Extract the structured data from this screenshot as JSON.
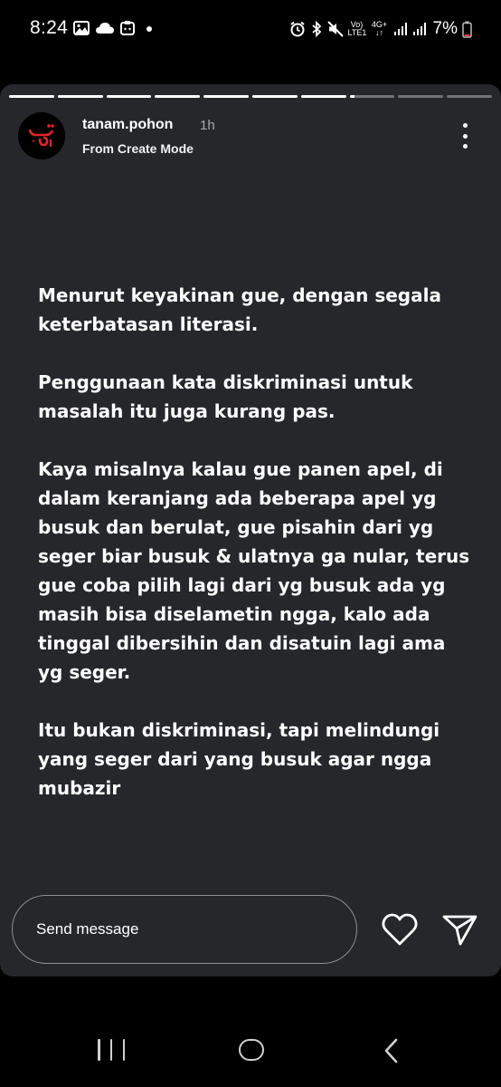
{
  "status_bar": {
    "time": "8:24",
    "left_icons": [
      "image-icon",
      "cloud-icon",
      "clipboard-icon"
    ],
    "network_label_top": "Vo)",
    "network_label_bottom": "LTE1",
    "network_type": "4G+",
    "battery_percent": "7%",
    "right_icons": [
      "alarm-icon",
      "bluetooth-icon",
      "mute-icon",
      "signal-icon",
      "signal-icon",
      "battery-icon"
    ]
  },
  "story": {
    "progress": {
      "segment_count": 10,
      "completed_segments": 7,
      "current_segment_fill": 0.1
    },
    "username": "tanam.pohon",
    "time_ago": "1h",
    "subtitle": "From Create Mode",
    "paragraphs": [
      "Menurut keyakinan gue, dengan segala keterbatasan literasi.",
      "Penggunaan kata diskriminasi untuk masalah itu juga kurang pas.",
      "Kaya misalnya kalau gue panen apel, di dalam keranjang ada beberapa apel yg busuk dan berulat, gue pisahin dari yg seger biar busuk & ulatnya ga nular, terus gue coba pilih lagi dari yg busuk ada yg masih bisa diselametin ngga, kalo ada tinggal dibersihin dan disatuin lagi ama yg seger.",
      "Itu bukan diskriminasi, tapi melindungi yang seger dari yang busuk agar ngga mubazir"
    ],
    "message_placeholder": "Send message"
  },
  "colors": {
    "card_background": "#26272b",
    "page_background": "#000000",
    "avatar_accent": "#e0252b"
  }
}
